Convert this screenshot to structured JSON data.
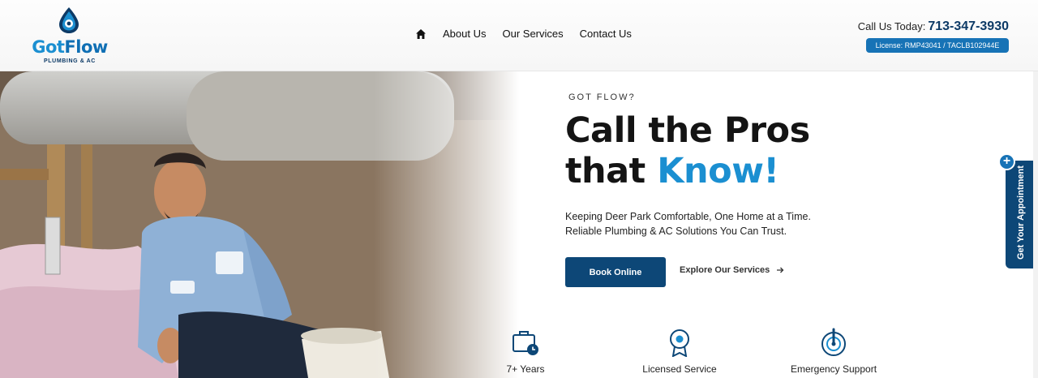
{
  "header": {
    "logo": {
      "brand_part1": "Got",
      "brand_part2": "Flow",
      "tagline": "PLUMBING & AC"
    },
    "nav": [
      {
        "label": "About Us"
      },
      {
        "label": "Our Services"
      },
      {
        "label": "Contact Us"
      }
    ],
    "call_label": "Call Us Today:",
    "phone": "713-347-3930",
    "license": "License: RMP43041 / TACLB102944E"
  },
  "hero": {
    "eyebrow": "GOT FLOW?",
    "headline_line1": "Call the Pros",
    "headline_line2_plain": "that ",
    "headline_line2_accent": "Know!",
    "sub_line1": "Keeping Deer Park Comfortable, One Home at a Time.",
    "sub_line2": "Reliable Plumbing & AC Solutions You Can Trust.",
    "book_label": "Book Online",
    "explore_label": "Explore Our Services"
  },
  "features": [
    {
      "label": "7+ Years",
      "icon": "briefcase-clock-icon"
    },
    {
      "label": "Licensed Service",
      "icon": "certificate-badge-icon"
    },
    {
      "label": "Emergency Support",
      "icon": "emergency-pin-icon"
    }
  ],
  "side_tab": {
    "label": "Get Your Appointment"
  },
  "colors": {
    "navy": "#0d4777",
    "accent": "#1b8fd1",
    "license_bg": "#1773b6"
  }
}
